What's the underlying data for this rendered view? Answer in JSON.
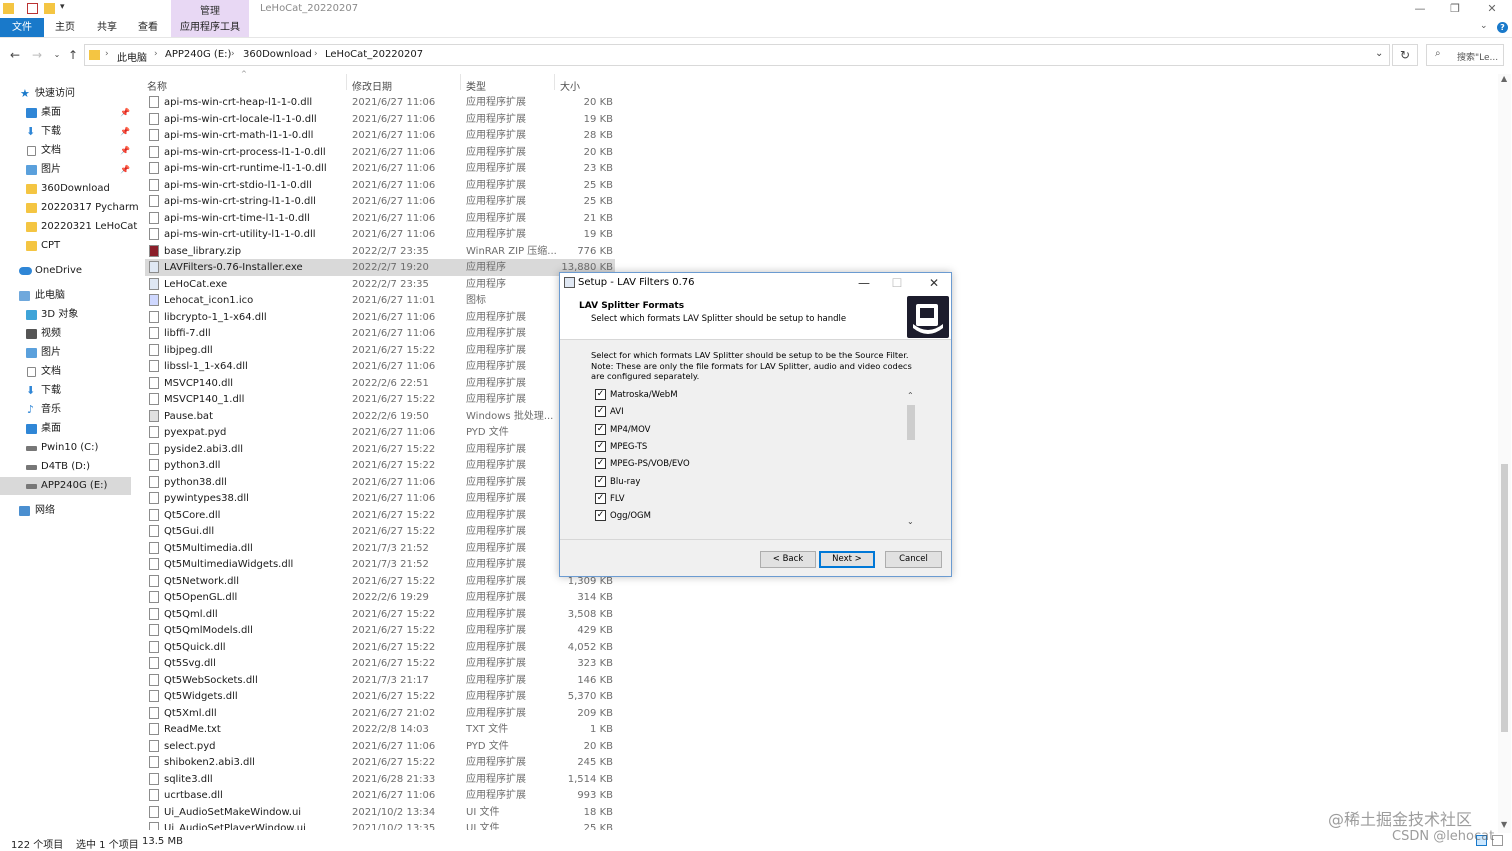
{
  "titlebar": {
    "manage_tab": "管理",
    "window_title": "LeHoCat_20220207"
  },
  "ribbon": {
    "tabs": [
      "文件",
      "主页",
      "共享",
      "查看",
      "应用程序工具"
    ]
  },
  "address": {
    "crumbs": [
      "此电脑",
      "APP240G (E:)",
      "360Download",
      "LeHoCat_20220207"
    ],
    "search_placeholder": "搜索\"Le..."
  },
  "nav": {
    "quick_access": "快速访问",
    "quick_items": [
      "桌面",
      "下载",
      "文档",
      "图片",
      "360Download",
      "20220317 Pycharm",
      "20220321 LeHoCat",
      "CPT"
    ],
    "onedrive": "OneDrive",
    "this_pc": "此电脑",
    "pc_items": [
      "3D 对象",
      "视频",
      "图片",
      "文档",
      "下载",
      "音乐",
      "桌面",
      "Pwin10 (C:)",
      "D4TB (D:)",
      "APP240G (E:)"
    ],
    "network": "网络"
  },
  "columns": {
    "name": "名称",
    "date": "修改日期",
    "type": "类型",
    "size": "大小"
  },
  "files": [
    {
      "name": "api-ms-win-crt-heap-l1-1-0.dll",
      "date": "2021/6/27 11:06",
      "type": "应用程序扩展",
      "size": "20 KB"
    },
    {
      "name": "api-ms-win-crt-locale-l1-1-0.dll",
      "date": "2021/6/27 11:06",
      "type": "应用程序扩展",
      "size": "19 KB"
    },
    {
      "name": "api-ms-win-crt-math-l1-1-0.dll",
      "date": "2021/6/27 11:06",
      "type": "应用程序扩展",
      "size": "28 KB"
    },
    {
      "name": "api-ms-win-crt-process-l1-1-0.dll",
      "date": "2021/6/27 11:06",
      "type": "应用程序扩展",
      "size": "20 KB"
    },
    {
      "name": "api-ms-win-crt-runtime-l1-1-0.dll",
      "date": "2021/6/27 11:06",
      "type": "应用程序扩展",
      "size": "23 KB"
    },
    {
      "name": "api-ms-win-crt-stdio-l1-1-0.dll",
      "date": "2021/6/27 11:06",
      "type": "应用程序扩展",
      "size": "25 KB"
    },
    {
      "name": "api-ms-win-crt-string-l1-1-0.dll",
      "date": "2021/6/27 11:06",
      "type": "应用程序扩展",
      "size": "25 KB"
    },
    {
      "name": "api-ms-win-crt-time-l1-1-0.dll",
      "date": "2021/6/27 11:06",
      "type": "应用程序扩展",
      "size": "21 KB"
    },
    {
      "name": "api-ms-win-crt-utility-l1-1-0.dll",
      "date": "2021/6/27 11:06",
      "type": "应用程序扩展",
      "size": "19 KB"
    },
    {
      "name": "base_library.zip",
      "date": "2022/2/7 23:35",
      "type": "WinRAR ZIP 压缩...",
      "size": "776 KB"
    },
    {
      "name": "LAVFilters-0.76-Installer.exe",
      "date": "2022/2/7 19:20",
      "type": "应用程序",
      "size": "13,880 KB"
    },
    {
      "name": "LeHoCat.exe",
      "date": "2022/2/7 23:35",
      "type": "应用程序",
      "size": ""
    },
    {
      "name": "Lehocat_icon1.ico",
      "date": "2021/6/27 11:01",
      "type": "图标",
      "size": ""
    },
    {
      "name": "libcrypto-1_1-x64.dll",
      "date": "2021/6/27 11:06",
      "type": "应用程序扩展",
      "size": ""
    },
    {
      "name": "libffi-7.dll",
      "date": "2021/6/27 11:06",
      "type": "应用程序扩展",
      "size": ""
    },
    {
      "name": "libjpeg.dll",
      "date": "2021/6/27 15:22",
      "type": "应用程序扩展",
      "size": ""
    },
    {
      "name": "libssl-1_1-x64.dll",
      "date": "2021/6/27 11:06",
      "type": "应用程序扩展",
      "size": ""
    },
    {
      "name": "MSVCP140.dll",
      "date": "2022/2/6 22:51",
      "type": "应用程序扩展",
      "size": ""
    },
    {
      "name": "MSVCP140_1.dll",
      "date": "2021/6/27 15:22",
      "type": "应用程序扩展",
      "size": ""
    },
    {
      "name": "Pause.bat",
      "date": "2022/2/6 19:50",
      "type": "Windows 批处理...",
      "size": ""
    },
    {
      "name": "pyexpat.pyd",
      "date": "2021/6/27 11:06",
      "type": "PYD 文件",
      "size": ""
    },
    {
      "name": "pyside2.abi3.dll",
      "date": "2021/6/27 15:22",
      "type": "应用程序扩展",
      "size": ""
    },
    {
      "name": "python3.dll",
      "date": "2021/6/27 15:22",
      "type": "应用程序扩展",
      "size": ""
    },
    {
      "name": "python38.dll",
      "date": "2021/6/27 11:06",
      "type": "应用程序扩展",
      "size": ""
    },
    {
      "name": "pywintypes38.dll",
      "date": "2021/6/27 11:06",
      "type": "应用程序扩展",
      "size": ""
    },
    {
      "name": "Qt5Core.dll",
      "date": "2021/6/27 15:22",
      "type": "应用程序扩展",
      "size": ""
    },
    {
      "name": "Qt5Gui.dll",
      "date": "2021/6/27 15:22",
      "type": "应用程序扩展",
      "size": ""
    },
    {
      "name": "Qt5Multimedia.dll",
      "date": "2021/7/3 21:52",
      "type": "应用程序扩展",
      "size": ""
    },
    {
      "name": "Qt5MultimediaWidgets.dll",
      "date": "2021/7/3 21:52",
      "type": "应用程序扩展",
      "size": ""
    },
    {
      "name": "Qt5Network.dll",
      "date": "2021/6/27 15:22",
      "type": "应用程序扩展",
      "size": "1,309 KB"
    },
    {
      "name": "Qt5OpenGL.dll",
      "date": "2022/2/6 19:29",
      "type": "应用程序扩展",
      "size": "314 KB"
    },
    {
      "name": "Qt5Qml.dll",
      "date": "2021/6/27 15:22",
      "type": "应用程序扩展",
      "size": "3,508 KB"
    },
    {
      "name": "Qt5QmlModels.dll",
      "date": "2021/6/27 15:22",
      "type": "应用程序扩展",
      "size": "429 KB"
    },
    {
      "name": "Qt5Quick.dll",
      "date": "2021/6/27 15:22",
      "type": "应用程序扩展",
      "size": "4,052 KB"
    },
    {
      "name": "Qt5Svg.dll",
      "date": "2021/6/27 15:22",
      "type": "应用程序扩展",
      "size": "323 KB"
    },
    {
      "name": "Qt5WebSockets.dll",
      "date": "2021/7/3 21:17",
      "type": "应用程序扩展",
      "size": "146 KB"
    },
    {
      "name": "Qt5Widgets.dll",
      "date": "2021/6/27 15:22",
      "type": "应用程序扩展",
      "size": "5,370 KB"
    },
    {
      "name": "Qt5Xml.dll",
      "date": "2021/6/27 21:02",
      "type": "应用程序扩展",
      "size": "209 KB"
    },
    {
      "name": "ReadMe.txt",
      "date": "2022/2/8 14:03",
      "type": "TXT 文件",
      "size": "1 KB"
    },
    {
      "name": "select.pyd",
      "date": "2021/6/27 11:06",
      "type": "PYD 文件",
      "size": "20 KB"
    },
    {
      "name": "shiboken2.abi3.dll",
      "date": "2021/6/27 15:22",
      "type": "应用程序扩展",
      "size": "245 KB"
    },
    {
      "name": "sqlite3.dll",
      "date": "2021/6/28 21:33",
      "type": "应用程序扩展",
      "size": "1,514 KB"
    },
    {
      "name": "ucrtbase.dll",
      "date": "2021/6/27 11:06",
      "type": "应用程序扩展",
      "size": "993 KB"
    },
    {
      "name": "Ui_AudioSetMakeWindow.ui",
      "date": "2021/10/2 13:34",
      "type": "UI 文件",
      "size": "18 KB"
    },
    {
      "name": "Ui_AudioSetPlayerWindow.ui",
      "date": "2021/10/2 13:35",
      "type": "UI 文件",
      "size": "25 KB"
    }
  ],
  "status": {
    "count": "122 个项目",
    "selected": "选中 1 个项目",
    "size": "13.5 MB"
  },
  "watermark": {
    "line1": "@稀土掘金技术社区",
    "line2": "CSDN @lehocat"
  },
  "dialog": {
    "title": "Setup - LAV Filters 0.76",
    "heading": "LAV Splitter Formats",
    "subheading": "Select which formats LAV Splitter should be setup to handle",
    "desc1": "Select for which formats LAV Splitter should be setup to be the Source Filter.",
    "desc2": "Note: These are only the file formats for LAV Splitter, audio and video codecs are configured separately.",
    "formats": [
      {
        "label": "Matroska/WebM",
        "checked": true
      },
      {
        "label": "AVI",
        "checked": true
      },
      {
        "label": "MP4/MOV",
        "checked": true
      },
      {
        "label": "MPEG-TS",
        "checked": true
      },
      {
        "label": "MPEG-PS/VOB/EVO",
        "checked": true
      },
      {
        "label": "Blu-ray",
        "checked": true
      },
      {
        "label": "FLV",
        "checked": true
      },
      {
        "label": "Ogg/OGM",
        "checked": true
      }
    ],
    "back": "< Back",
    "next": "Next >",
    "cancel": "Cancel"
  },
  "colors": {
    "accent": "#1979ca",
    "manage_tab": "#e8d8f4",
    "selection": "#cce8ff",
    "row_selected": "#d9d9d9"
  }
}
